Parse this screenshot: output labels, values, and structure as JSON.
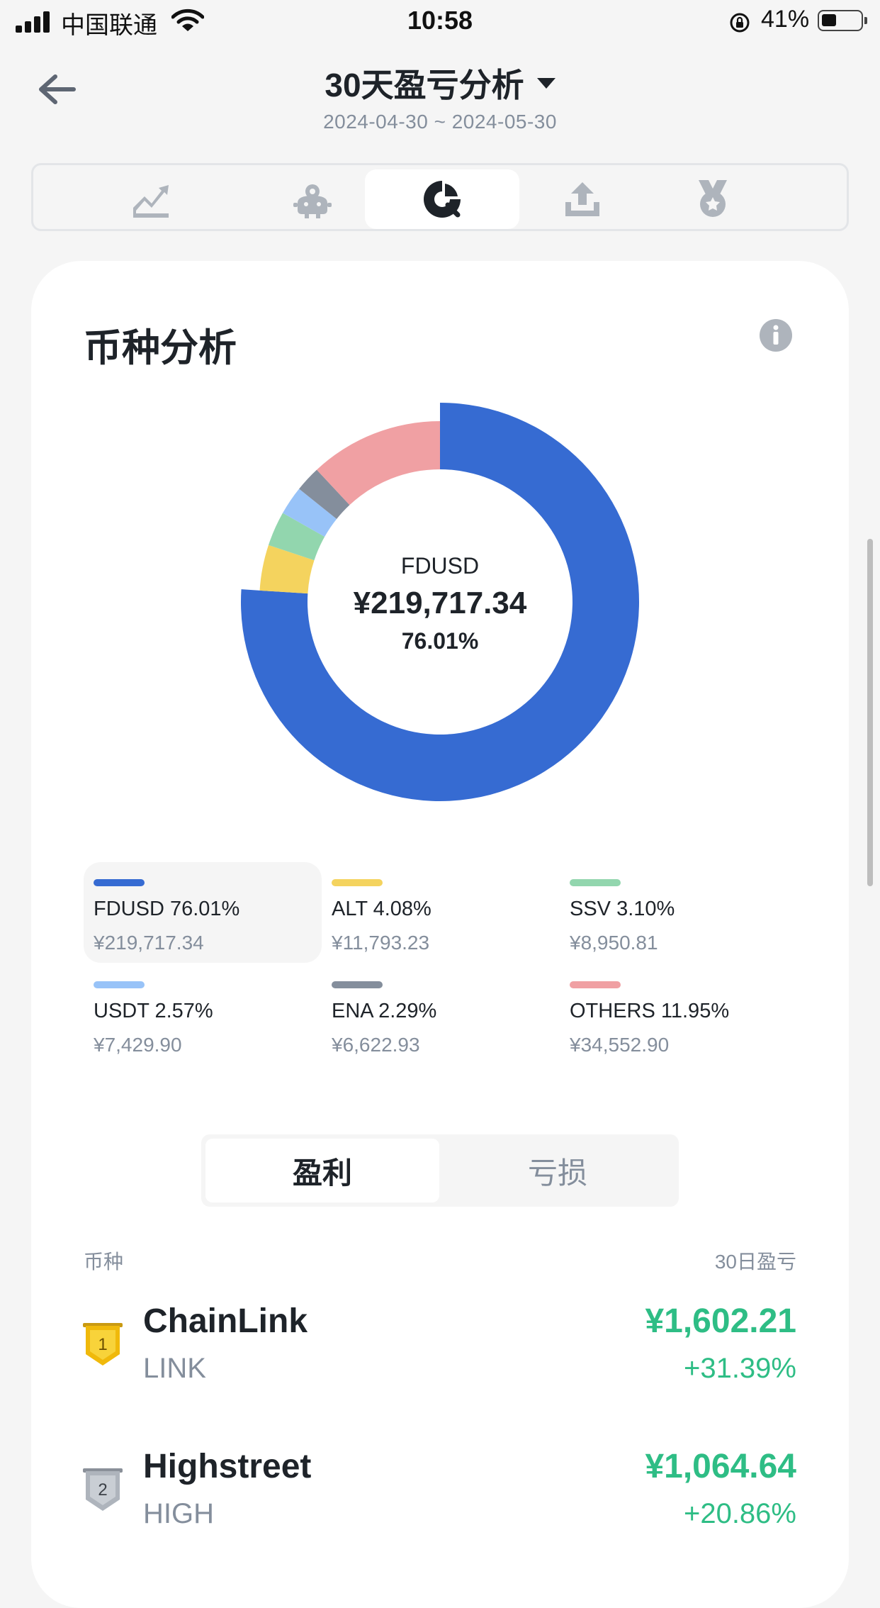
{
  "status_bar": {
    "carrier": "中国联通",
    "time": "10:58",
    "battery": "41%"
  },
  "header": {
    "title": "30天盈亏分析",
    "date_range": "2024-04-30 ~ 2024-05-30"
  },
  "tabs": [
    {
      "icon": "trend-chart-icon",
      "active": false
    },
    {
      "icon": "piggy-bank-icon",
      "active": false
    },
    {
      "icon": "pie-analysis-icon",
      "active": true
    },
    {
      "icon": "upload-tray-icon",
      "active": false
    },
    {
      "icon": "medal-icon",
      "active": false
    }
  ],
  "card": {
    "title": "币种分析"
  },
  "donut_center": {
    "asset": "FDUSD",
    "value": "¥219,717.34",
    "percent": "76.01%"
  },
  "chart_data": {
    "type": "pie",
    "categories": [
      "FDUSD",
      "ALT",
      "SSV",
      "USDT",
      "ENA",
      "OTHERS"
    ],
    "values": [
      76.01,
      4.08,
      3.1,
      2.57,
      2.29,
      11.95
    ],
    "colors": [
      "#366bd2",
      "#f4d35e",
      "#92d6ae",
      "#98c3f8",
      "#848e9c",
      "#f0a0a3"
    ],
    "selected": "FDUSD"
  },
  "legend": [
    {
      "label": "FDUSD 76.01%",
      "amount": "¥219,717.34",
      "color": "#366bd2",
      "selected": true
    },
    {
      "label": "ALT 4.08%",
      "amount": "¥11,793.23",
      "color": "#f4d35e",
      "selected": false
    },
    {
      "label": "SSV 3.10%",
      "amount": "¥8,950.81",
      "color": "#92d6ae",
      "selected": false
    },
    {
      "label": "USDT 2.57%",
      "amount": "¥7,429.90",
      "color": "#98c3f8",
      "selected": false
    },
    {
      "label": "ENA 2.29%",
      "amount": "¥6,622.93",
      "color": "#848e9c",
      "selected": false
    },
    {
      "label": "OTHERS 11.95%",
      "amount": "¥34,552.90",
      "color": "#f0a0a3",
      "selected": false
    }
  ],
  "segment": {
    "profit": "盈利",
    "loss": "亏损"
  },
  "list": {
    "col_coin": "币种",
    "col_pnl": "30日盈亏",
    "rows": [
      {
        "rank": "1",
        "name": "ChainLink",
        "symbol": "LINK",
        "pnl": "¥1,602.21",
        "pct": "+31.39%"
      },
      {
        "rank": "2",
        "name": "Highstreet",
        "symbol": "HIGH",
        "pnl": "¥1,064.64",
        "pct": "+20.86%"
      }
    ]
  },
  "colors": {
    "up": "#2ebd85",
    "text_primary": "#1e2329",
    "text_secondary": "#848e9c"
  }
}
